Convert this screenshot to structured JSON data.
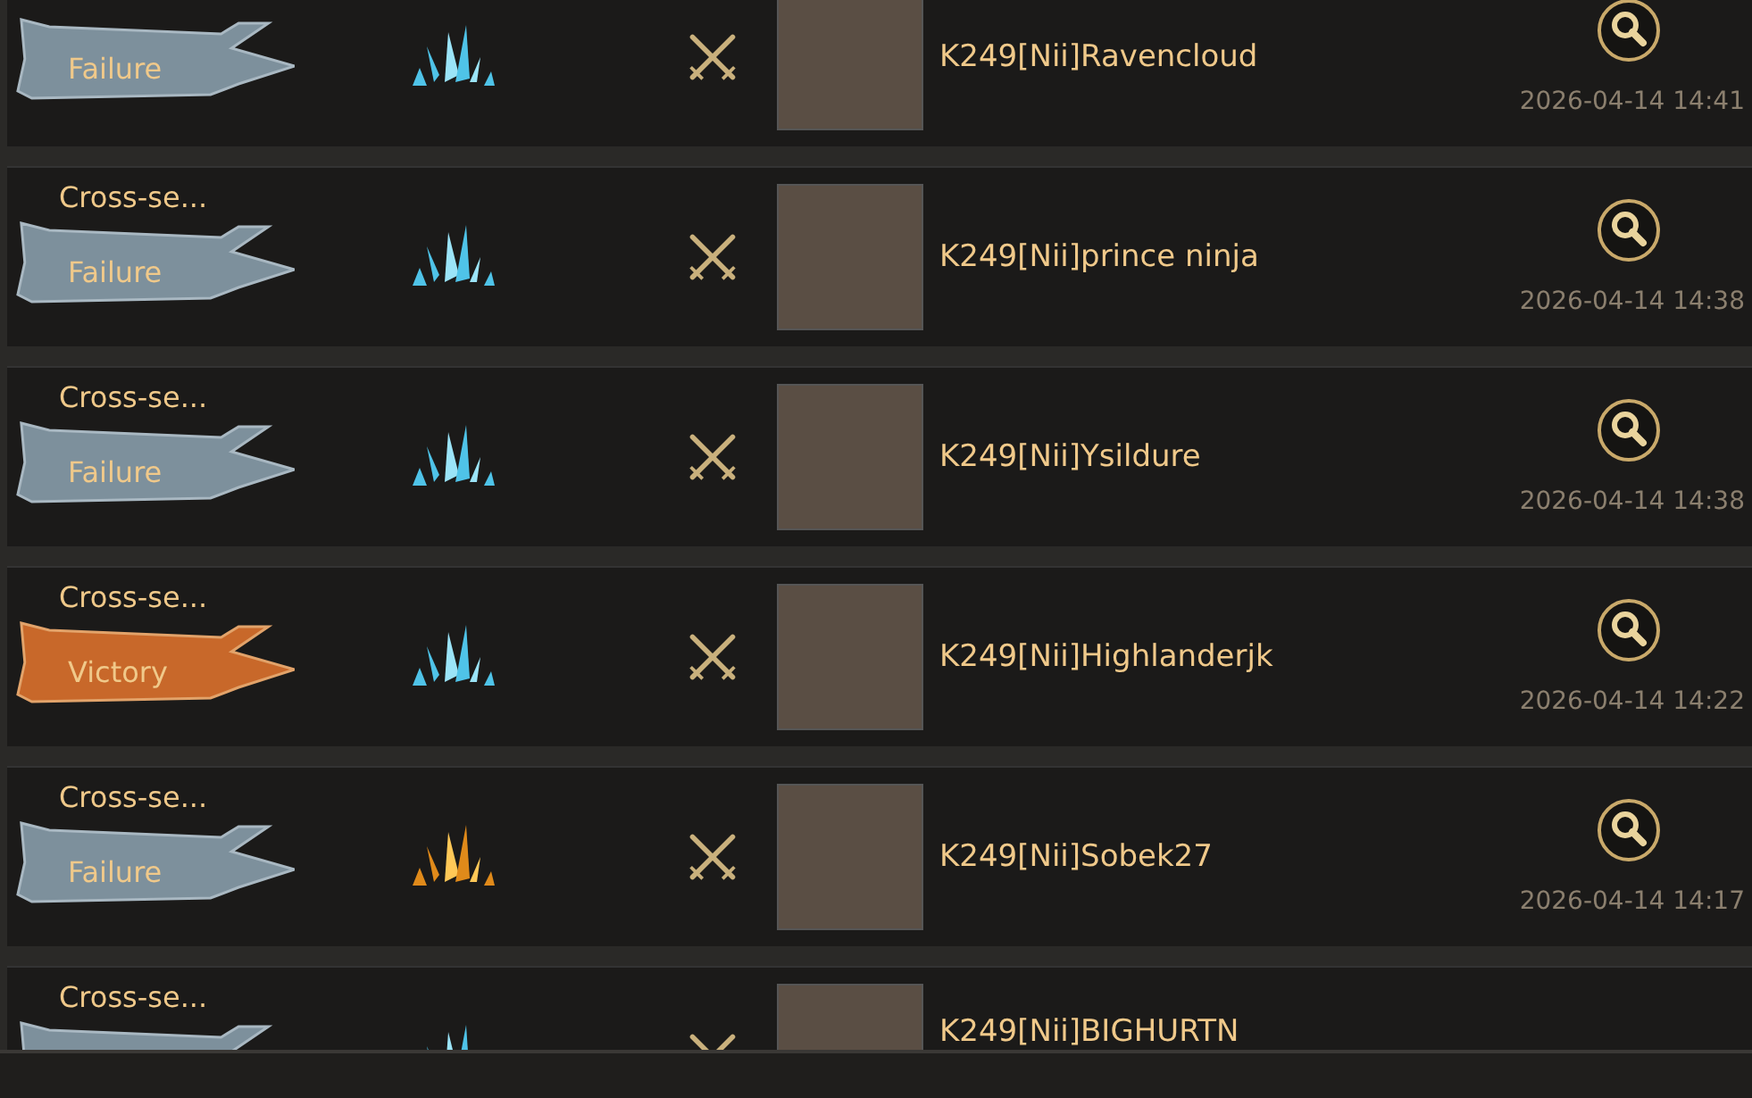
{
  "battle_log": [
    {
      "result": {
        "label": "Failure",
        "kind": "failure"
      },
      "resource": {
        "kind": "blue"
      },
      "opponent": "K249[Nii]Ravencloud",
      "time": "2026-04-14 14:41"
    },
    {
      "title": "Cross-se...",
      "result": {
        "label": "Failure",
        "kind": "failure"
      },
      "resource": {
        "kind": "blue"
      },
      "opponent": "K249[Nii]prince ninja",
      "time": "2026-04-14 14:38"
    },
    {
      "title": "Cross-se...",
      "result": {
        "label": "Failure",
        "kind": "failure"
      },
      "resource": {
        "kind": "blue"
      },
      "opponent": "K249[Nii]Ysildure",
      "time": "2026-04-14 14:38"
    },
    {
      "title": "Cross-se...",
      "result": {
        "label": "Victory",
        "kind": "victory"
      },
      "resource": {
        "kind": "blue"
      },
      "opponent": "K249[Nii]Highlanderjk",
      "time": "2026-04-14 14:22"
    },
    {
      "title": "Cross-se...",
      "result": {
        "label": "Failure",
        "kind": "failure"
      },
      "resource": {
        "kind": "gold"
      },
      "opponent": "K249[Nii]Sobek27",
      "time": "2026-04-14 14:17"
    },
    {
      "title": "Cross-se...",
      "result": {
        "kind": "failure"
      },
      "resource": {
        "kind": "blue"
      },
      "opponent": "K249[Nii]BIGHURTN"
    }
  ]
}
